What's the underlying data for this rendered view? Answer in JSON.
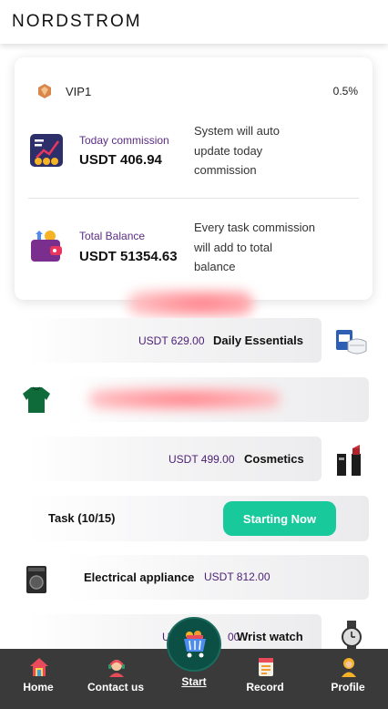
{
  "header": {
    "brand": "NORDSTROM"
  },
  "vip": {
    "level": "VIP1",
    "rate": "0.5%"
  },
  "stats": {
    "today": {
      "label": "Today commission",
      "value": "USDT 406.94",
      "desc": "System will auto update today commission"
    },
    "balance": {
      "label": "Total Balance",
      "value": "USDT 51354.63",
      "desc": "Every task commission will add to total balance"
    }
  },
  "products": [
    {
      "price": "USDT 629.00",
      "name": "Daily Essentials",
      "icon": "face-mask-box-icon"
    },
    {
      "price": "",
      "name": "",
      "icon": "green-sweater-icon"
    },
    {
      "price": "USDT 499.00",
      "name": "Cosmetics",
      "icon": "lipstick-icon"
    },
    {
      "price": "USDT 812.00",
      "name": "Electrical appliance",
      "icon": "washing-machine-icon"
    },
    {
      "price": "U",
      "price_tail": "00",
      "name": "Wrist watch",
      "icon": "wrist-watch-icon"
    }
  ],
  "task": {
    "label": "Task (10/15)",
    "button": "Starting Now"
  },
  "nav": {
    "home": "Home",
    "contact": "Contact us",
    "start": "Start",
    "record": "Record",
    "profile": "Profile"
  },
  "colors": {
    "accent": "#18c99b",
    "nav_bg": "#3a3a3a",
    "price_text": "#4b1f73"
  }
}
